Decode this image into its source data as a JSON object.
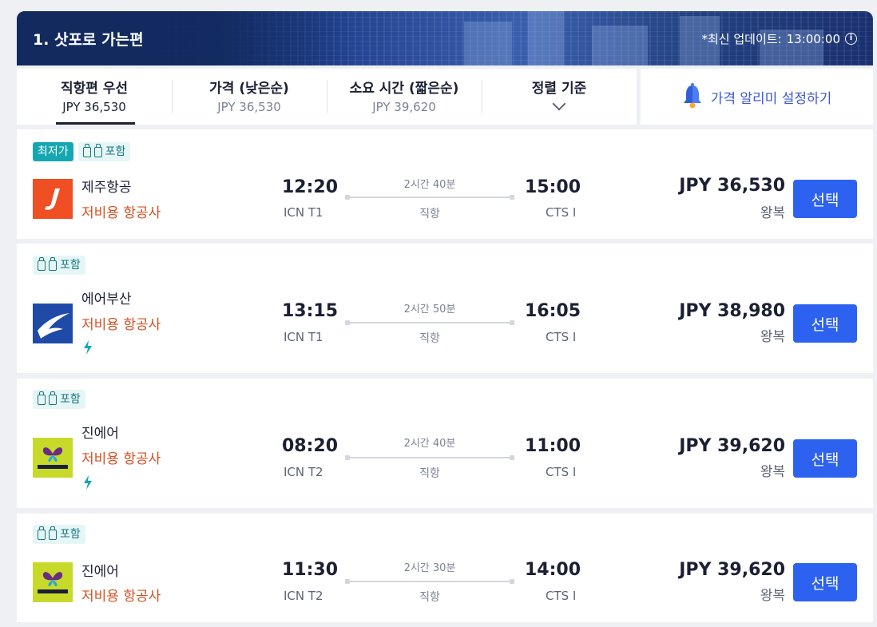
{
  "header": {
    "title": "1. 삿포로 가는편",
    "update_label": "*최신 업데이트:",
    "update_time": "13:00:00"
  },
  "sort_tabs": [
    {
      "label": "직항편 우선",
      "value": "JPY 36,530"
    },
    {
      "label": "가격 (낮은순)",
      "value": "JPY 36,530"
    },
    {
      "label": "소요 시간 (짧은순)",
      "value": "JPY 39,620"
    },
    {
      "label": "정렬 기준",
      "value": ""
    }
  ],
  "price_alert": {
    "label": "가격 알리미 설정하기"
  },
  "flights": [
    {
      "badge_lowest": "최저가",
      "badge_bag": "포함",
      "airline": "제주항공",
      "airline_type": "저비용 항공사",
      "depart_time": "12:20",
      "depart_airport": "ICN T1",
      "duration": "2시간 40분",
      "stops": "직항",
      "arrive_time": "15:00",
      "arrive_airport": "CTS I",
      "price": "JPY 36,530",
      "trip_type": "왕복",
      "select_label": "선택",
      "logo": "jeju-air-logo",
      "has_bolt": false
    },
    {
      "badge_bag": "포함",
      "airline": "에어부산",
      "airline_type": "저비용 항공사",
      "depart_time": "13:15",
      "depart_airport": "ICN T1",
      "duration": "2시간 50분",
      "stops": "직항",
      "arrive_time": "16:05",
      "arrive_airport": "CTS I",
      "price": "JPY 38,980",
      "trip_type": "왕복",
      "select_label": "선택",
      "logo": "air-busan-logo",
      "has_bolt": true
    },
    {
      "badge_bag": "포함",
      "airline": "진에어",
      "airline_type": "저비용 항공사",
      "depart_time": "08:20",
      "depart_airport": "ICN T2",
      "duration": "2시간 40분",
      "stops": "직항",
      "arrive_time": "11:00",
      "arrive_airport": "CTS I",
      "price": "JPY 39,620",
      "trip_type": "왕복",
      "select_label": "선택",
      "logo": "jin-air-logo",
      "has_bolt": true
    },
    {
      "badge_bag": "포함",
      "airline": "진에어",
      "airline_type": "저비용 항공사",
      "depart_time": "11:30",
      "depart_airport": "ICN T2",
      "duration": "2시간 30분",
      "stops": "직항",
      "arrive_time": "14:00",
      "arrive_airport": "CTS I",
      "price": "JPY 39,620",
      "trip_type": "왕복",
      "select_label": "선택",
      "logo": "jin-air-logo",
      "has_bolt": false
    }
  ],
  "colors": {
    "accent": "#2d62f0",
    "low_cost": "#d64f1f",
    "lowest_badge": "#14a7b3",
    "header_bg": "#122a5e"
  }
}
